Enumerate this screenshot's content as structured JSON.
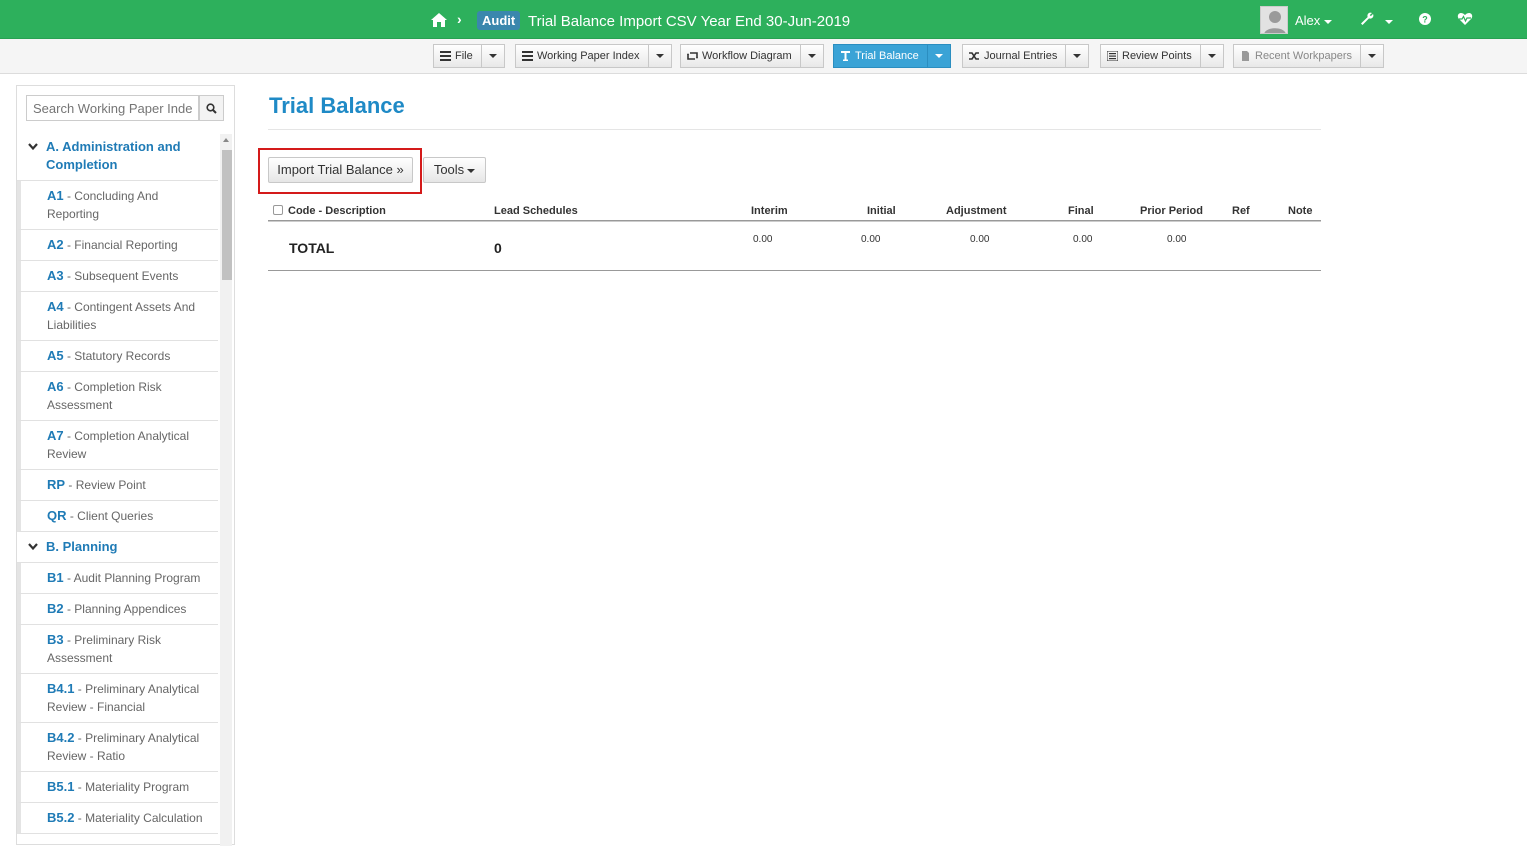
{
  "header": {
    "separator": "›",
    "badge": "Audit",
    "title": "Trial Balance Import CSV  Year End 30-Jun-2019",
    "user": "Alex"
  },
  "toolbar": {
    "file": "File",
    "working_paper_index": "Working Paper Index",
    "workflow_diagram": "Workflow Diagram",
    "trial_balance": "Trial Balance",
    "journal_entries": "Journal Entries",
    "review_points": "Review Points",
    "recent_workpapers": "Recent Workpapers"
  },
  "sidebar": {
    "search_placeholder": "Search Working Paper Index",
    "sections": [
      {
        "title": "A. Administration and Completion",
        "items": [
          {
            "code": "A1",
            "label": " - Concluding And Reporting"
          },
          {
            "code": "A2",
            "label": " - Financial Reporting"
          },
          {
            "code": "A3",
            "label": " - Subsequent Events"
          },
          {
            "code": "A4",
            "label": " - Contingent Assets And Liabilities"
          },
          {
            "code": "A5",
            "label": " - Statutory Records"
          },
          {
            "code": "A6",
            "label": " - Completion Risk Assessment"
          },
          {
            "code": "A7",
            "label": " - Completion Analytical Review"
          },
          {
            "code": "RP",
            "label": " - Review Point"
          },
          {
            "code": "QR",
            "label": " - Client Queries"
          }
        ]
      },
      {
        "title": "B. Planning",
        "items": [
          {
            "code": "B1",
            "label": " - Audit Planning Program"
          },
          {
            "code": "B2",
            "label": " - Planning Appendices"
          },
          {
            "code": "B3",
            "label": " - Preliminary Risk Assessment"
          },
          {
            "code": "B4.1",
            "label": " - Preliminary Analytical Review - Financial"
          },
          {
            "code": "B4.2",
            "label": " - Preliminary Analytical Review - Ratio"
          },
          {
            "code": "B5.1",
            "label": " - Materiality Program"
          },
          {
            "code": "B5.2",
            "label": " - Materiality Calculation"
          }
        ]
      }
    ]
  },
  "main": {
    "title": "Trial Balance",
    "import_button": "Import Trial Balance »",
    "tools_button": "Tools",
    "columns": {
      "code_description": "Code - Description",
      "lead_schedules": "Lead Schedules",
      "interim": "Interim",
      "initial": "Initial",
      "adjustment": "Adjustment",
      "final": "Final",
      "prior_period": "Prior Period",
      "ref": "Ref",
      "note": "Note"
    },
    "total": {
      "label": "TOTAL",
      "lead": "0",
      "interim": "0.00",
      "initial": "0.00",
      "adjustment": "0.00",
      "final": "0.00",
      "prior_period": "0.00"
    }
  },
  "colors": {
    "header_green": "#2db05c",
    "accent_blue": "#1f8ac6",
    "active_tab": "#3aa3d6",
    "highlight_red": "#d41a1a"
  }
}
